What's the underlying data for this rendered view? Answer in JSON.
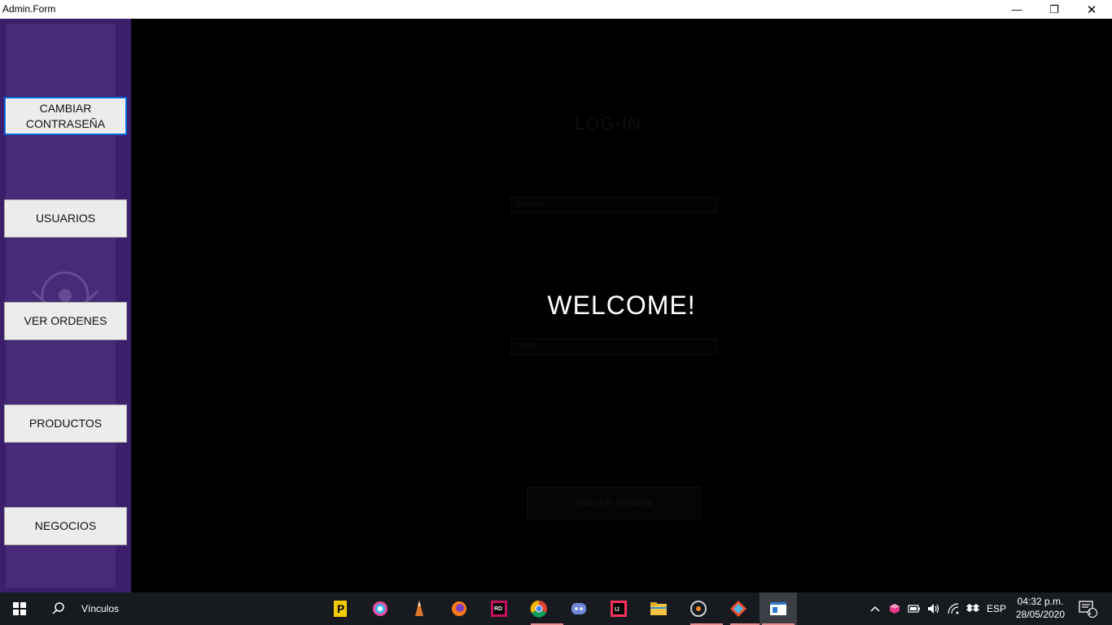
{
  "window": {
    "title": "Admin.Form",
    "controls": {
      "minimize": "—",
      "maximize": "❐",
      "close": "✕"
    }
  },
  "sidebar": {
    "buttons": [
      {
        "label": "CAMBIAR\nCONTRASEÑA",
        "focused": true
      },
      {
        "label": "USUARIOS"
      },
      {
        "label": "VER ORDENES"
      },
      {
        "label": "PRODUCTOS"
      },
      {
        "label": "NEGOCIOS"
      }
    ]
  },
  "main": {
    "background_form": {
      "title": "LOG-IN",
      "username_value": "Usuario",
      "password_value": "Clave",
      "submit_label": "INICIAR SESION"
    },
    "welcome_text": "WELCOME!"
  },
  "taskbar": {
    "search_label": "Vínculos",
    "apps": [
      "pinned-p-icon",
      "paint-icon",
      "pencil-icon",
      "firefox-icon",
      "rider-icon",
      "chrome-icon",
      "discord-icon",
      "intellij-icon",
      "file-explorer-icon",
      "media-player-icon",
      "git-icon",
      "active-window-icon"
    ],
    "tray": {
      "language": "ESP",
      "notification_count": "1"
    },
    "clock": {
      "time": "04:32 p.m.",
      "date": "28/05/2020"
    }
  },
  "colors": {
    "sidebar": "#3c1f6a",
    "sidebar_inner": "#472a78",
    "button_face": "#ececec",
    "focus_border": "#0a64d8",
    "main_bg": "#000000",
    "taskbar": "#171b20"
  }
}
